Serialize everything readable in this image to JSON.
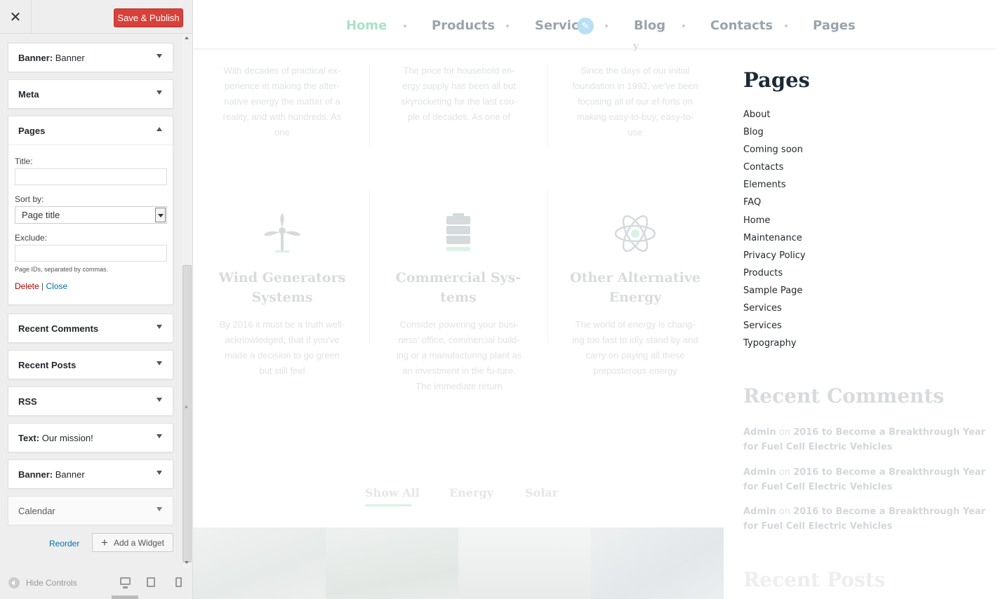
{
  "customizer": {
    "close_glyph": "✕",
    "publish_label": "Save & Publish",
    "widgets": [
      {
        "type": "Banner:",
        "title": "Banner"
      },
      {
        "type": "Meta",
        "title": ""
      },
      {
        "type": "Pages",
        "title": ""
      },
      {
        "type": "Recent Comments",
        "title": ""
      },
      {
        "type": "Recent Posts",
        "title": ""
      },
      {
        "type": "RSS",
        "title": ""
      },
      {
        "type": "Text:",
        "title": "Our mission!"
      },
      {
        "type": "Banner:",
        "title": "Banner"
      },
      {
        "type": "Calendar",
        "title": ""
      }
    ],
    "pages_form": {
      "title_label": "Title:",
      "title_value": "",
      "sortby_label": "Sort by:",
      "sortby_value": "Page title",
      "exclude_label": "Exclude:",
      "exclude_value": "",
      "exclude_hint": "Page IDs, separated by commas.",
      "delete_label": "Delete",
      "separator": "|",
      "close_label": "Close"
    },
    "reorder_label": "Reorder",
    "add_widget_label": "Add a Widget",
    "add_widget_glyph": "+",
    "hide_controls_label": "Hide Controls",
    "scroll_grip": "≡"
  },
  "preview": {
    "nav": [
      "Home",
      "Products",
      "Service",
      "Blog",
      "Contacts",
      "Pages"
    ],
    "edit_glyph": "✎",
    "top_partial_title": "y",
    "top_texts": [
      "With decades of practical ex-perience in making the alter-native energy the matter of a reality, and with hundreds. As one",
      "The price for household en-ergy supply has been all but skyrocketing for the last cou-ple of decades. As one of",
      "Since the days of our initial foundation in 1992, we've been focusing all of our ef-forts on making easy-to-buy, easy-to-use"
    ],
    "services": [
      {
        "icon": "wind-turbine-icon",
        "title": "Wind Generators Systems",
        "text": "By 2016 it must be a truth well-acknowledged, that if you've made a decision to go green but still feel"
      },
      {
        "icon": "battery-icon",
        "title": "Commercial Sys-tems",
        "text": "Consider powering your busi-ness' office, commercial build-ing or a manufacturing plant as an investment in the fu-ture. The immediate return"
      },
      {
        "icon": "atom-icon",
        "title": "Other Alternative Energy",
        "text": "The world of energy is chang-ing too fast to idly stand by and carry on paying all these preposterous energy"
      }
    ],
    "filters": [
      "Show All",
      "Energy",
      "Solar"
    ],
    "sidebar": {
      "pages_title": "Pages",
      "pages": [
        "About",
        "Blog",
        "Coming soon",
        "Contacts",
        "Elements",
        "FAQ",
        "Home",
        "Maintenance",
        "Privacy Policy",
        "Products",
        "Sample Page",
        "Services",
        "Services",
        "Typography"
      ],
      "recent_comments_title": "Recent Comments",
      "comments": [
        {
          "author": "Admin",
          "on": "on",
          "post": "2016 to Become a Breakthrough Year for Fuel Cell Electric Vehicles"
        },
        {
          "author": "Admin",
          "on": "on",
          "post": "2016 to Become a Breakthrough Year for Fuel Cell Electric Vehicles"
        },
        {
          "author": "Admin",
          "on": "on",
          "post": "2016 to Become a Breakthrough Year for Fuel Cell Electric Vehicles"
        }
      ],
      "recent_posts_title": "Recent Posts"
    }
  },
  "colors": {
    "publish": "#d8413a",
    "link": "#0073aa",
    "delete": "#aa0000",
    "nav_active": "#a9e2c6"
  }
}
